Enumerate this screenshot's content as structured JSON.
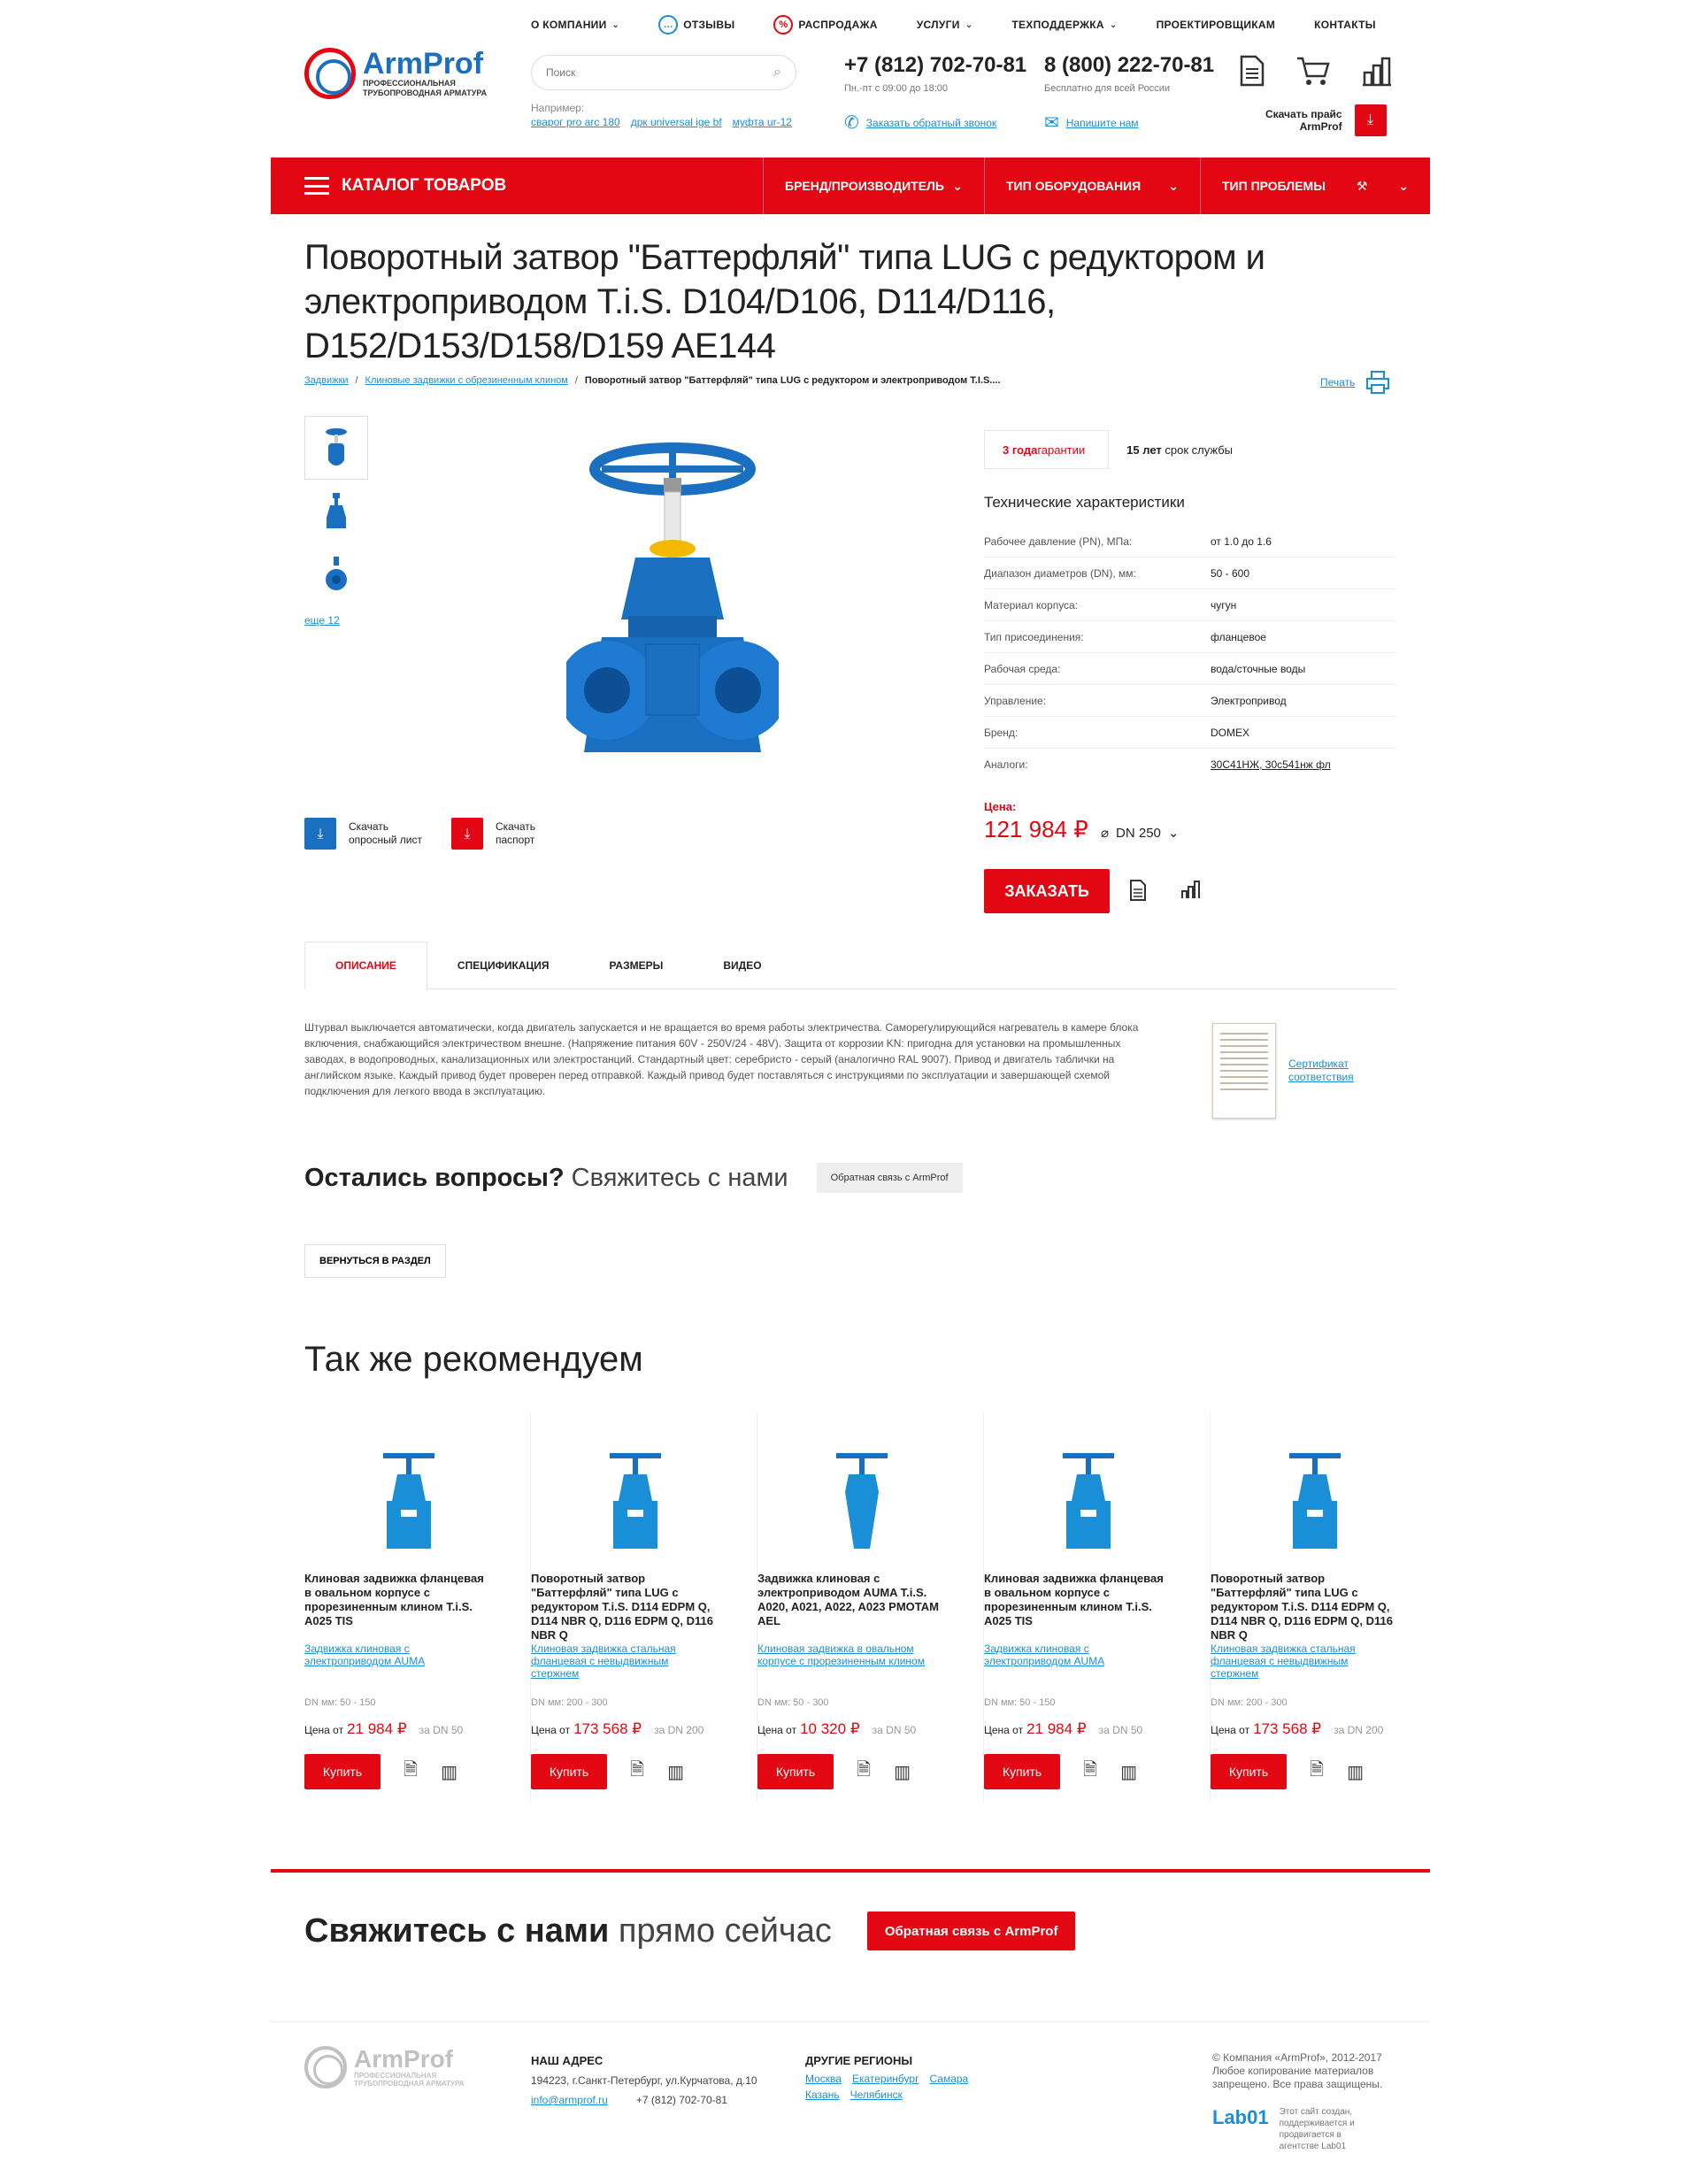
{
  "topnav": {
    "items": [
      {
        "label": "О КОМПАНИИ"
      },
      {
        "label": "ОТЗЫВЫ"
      },
      {
        "label": "РАСПРОДАЖА"
      },
      {
        "label": "УСЛУГИ"
      },
      {
        "label": "ТЕХПОДДЕРЖКА"
      },
      {
        "label": "ПРОЕКТИРОВЩИКАМ"
      },
      {
        "label": "КОНТАКТЫ"
      }
    ]
  },
  "logo": {
    "name": "ArmProf",
    "tagline1": "ПРОФЕССИОНАЛЬНАЯ",
    "tagline2": "ТРУБОПРОВОДНАЯ АРМАТУРА"
  },
  "search": {
    "placeholder": "Поиск",
    "hint_label": "Например:",
    "hints": [
      "сварог pro arc 180",
      "дрк universal ige bf",
      "муфта ur-12"
    ]
  },
  "contacts": {
    "phone1": "+7 (812) 702-70-81",
    "phone1_sub": "Пн.-пт с 09:00 до 18:00",
    "phone2": "8 (800) 222-70-81",
    "phone2_sub": "Бесплатно для всей России",
    "callback": "Заказать обратный звонок",
    "write": "Напишите нам"
  },
  "price_download": {
    "line1": "Скачать прайс",
    "line2": "ArmProf"
  },
  "rednav": {
    "catalog": "КАТАЛОГ ТОВАРОВ",
    "brand": "БРЕНД/ПРОИЗВОДИТЕЛЬ",
    "equipment": "ТИП ОБОРУДОВАНИЯ",
    "problem": "ТИП ПРОБЛЕМЫ"
  },
  "product": {
    "title": "Поворотный затвор \"Баттерфляй\" типа LUG с редуктором и электроприводом T.i.S. D104/D106, D114/D116, D152/D153/D158/D159 AE144",
    "breadcrumbs": [
      "Задвижки",
      "Клиновые задвижки с обрезиненным клином",
      "Поворотный затвор \"Баттерфляй\" типа LUG с редуктором и электроприводом T.I.S...."
    ],
    "print": "Печать",
    "more_images": "еще 12",
    "download_survey": {
      "line1": "Скачать",
      "line2": "опросный лист"
    },
    "download_passport": {
      "line1": "Скачать",
      "line2": "паспорт"
    },
    "warranty": {
      "strong": "3 года",
      "text": " гарантии"
    },
    "service_life": {
      "strong": "15 лет",
      "text": " срок службы"
    },
    "specs_title": "Технические характеристики",
    "specs": [
      {
        "k": "Рабочее давление (PN), МПа:",
        "v": "от 1.0 до 1.6"
      },
      {
        "k": "Диапазон диаметров (DN), мм:",
        "v": "50 - 600"
      },
      {
        "k": "Материал корпуса:",
        "v": "чугун"
      },
      {
        "k": "Тип присоединения:",
        "v": "фланцевое"
      },
      {
        "k": "Рабочая среда:",
        "v": "вода/сточные воды"
      },
      {
        "k": "Управление:",
        "v": "Электропривод"
      },
      {
        "k": "Бренд:",
        "v": "DOMEX"
      },
      {
        "k": "Аналоги:",
        "v": "30С41НЖ, 30с541нж фл"
      }
    ],
    "price_label": "Цена:",
    "price": "121 984 ₽",
    "dn": "DN 250",
    "order_button": "ЗАКАЗАТЬ"
  },
  "tabs": [
    "ОПИСАНИЕ",
    "СПЕЦИФИКАЦИЯ",
    "РАЗМЕРЫ",
    "ВИДЕО"
  ],
  "description": "Штурвал выключается автоматически, когда двигатель запускается и не вращается во время работы электричества. Саморегулирующийся нагреватель в камере блока включения, снабжающийся электричеством внешне. (Напряжение питания 60V - 250V/24 - 48V). Защита от коррозии KN: пригодна для установки на промышленных заводах, в водопроводных, канализационных или электростанций. Стандартный цвет: серебристо - серый (аналогично RAL 9007). Привод и двигатель таблички на английском языке. Каждый привод будет проверен перед отправкой. Каждый привод будет поставляться с инструкциями по эксплуатации и завершающей схемой подключения для легкого ввода в эксплуатацию.",
  "certificate": {
    "line1": "Сертификат",
    "line2": "соответствия"
  },
  "questions": {
    "bold": "Остались вопросы?",
    "light": " Свяжитесь с нами",
    "button": "Обратная связь с ArmProf"
  },
  "back_button": "ВЕРНУТЬСЯ В РАЗДЕЛ",
  "recommend_title": "Так же рекомендуем",
  "cards": [
    {
      "name": "Клиновая задвижка фланцевая в овальном корпусе с прорезиненным клином T.i.S. A025 TIS",
      "sub": "Задвижка клиновая с электроприводом AUMA",
      "dn": "DN мм: 50 - 150",
      "price_label": "Цена от",
      "price": "21 984 ₽",
      "za": "за DN 50",
      "buy": "Купить"
    },
    {
      "name": "Поворотный затвор \"Баттерфляй\" типа LUG с редуктором T.i.S. D114 EDPM Q, D114 NBR Q, D116 EDPM Q, D116 NBR Q",
      "sub": "Клиновая задвижка стальная фланцевая с невыдвижным стержнем",
      "dn": "DN мм: 200 - 300",
      "price_label": "Цена от",
      "price": "173 568 ₽",
      "za": "за DN 200",
      "buy": "Купить"
    },
    {
      "name": "Задвижка клиновая с электроприводом AUMA T.i.S. A020, A021, A022, A023 PMOTAM AEL",
      "sub": "Клиновая задвижка в овальном корпусе с прорезиненным клином",
      "dn": "DN мм: 50 - 300",
      "price_label": "Цена от",
      "price": "10 320 ₽",
      "za": "за DN 50",
      "buy": "Купить"
    },
    {
      "name": "Клиновая задвижка фланцевая в овальном корпусе с прорезиненным клином T.i.S. A025 TIS",
      "sub": "Задвижка клиновая с электроприводом AUMA",
      "dn": "DN мм: 50 - 150",
      "price_label": "Цена от",
      "price": "21 984 ₽",
      "za": "за DN 50",
      "buy": "Купить"
    },
    {
      "name": "Поворотный затвор \"Баттерфляй\" типа LUG с редуктором T.i.S. D114 EDPM Q, D114 NBR Q, D116 EDPM Q, D116 NBR Q",
      "sub": "Клиновая задвижка стальная фланцевая с невыдвижным стержнем",
      "dn": "DN мм: 200 - 300",
      "price_label": "Цена от",
      "price": "173 568 ₽",
      "za": "за DN 200",
      "buy": "Купить"
    }
  ],
  "contact_now": {
    "bold": "Свяжитесь с нами",
    "light": " прямо сейчас",
    "button": "Обратная связь с ArmProf"
  },
  "footer": {
    "address_title": "НАШ АДРЕС",
    "address": "194223, г.Санкт-Петербург, ул.Курчатова, д.10",
    "email": "info@armprof.ru",
    "phone": "+7 (812) 702-70-81",
    "regions_title": "ДРУГИЕ РЕГИОНЫ",
    "regions": [
      "Москва",
      "Екатеринбург",
      "Самара",
      "Казань",
      "Челябинск"
    ],
    "copyright": "© Компания «ArmProf», 2012-2017 Любое копирование материалов запрещено. Все права защищены.",
    "lab_logo": "Lab01",
    "lab_text": "Этот сайт создан, поддерживается и продвигается в агентстве Lab01"
  },
  "colors": {
    "accent": "#e30613",
    "brand_blue": "#1a6fc0",
    "link": "#1a8fd8"
  }
}
